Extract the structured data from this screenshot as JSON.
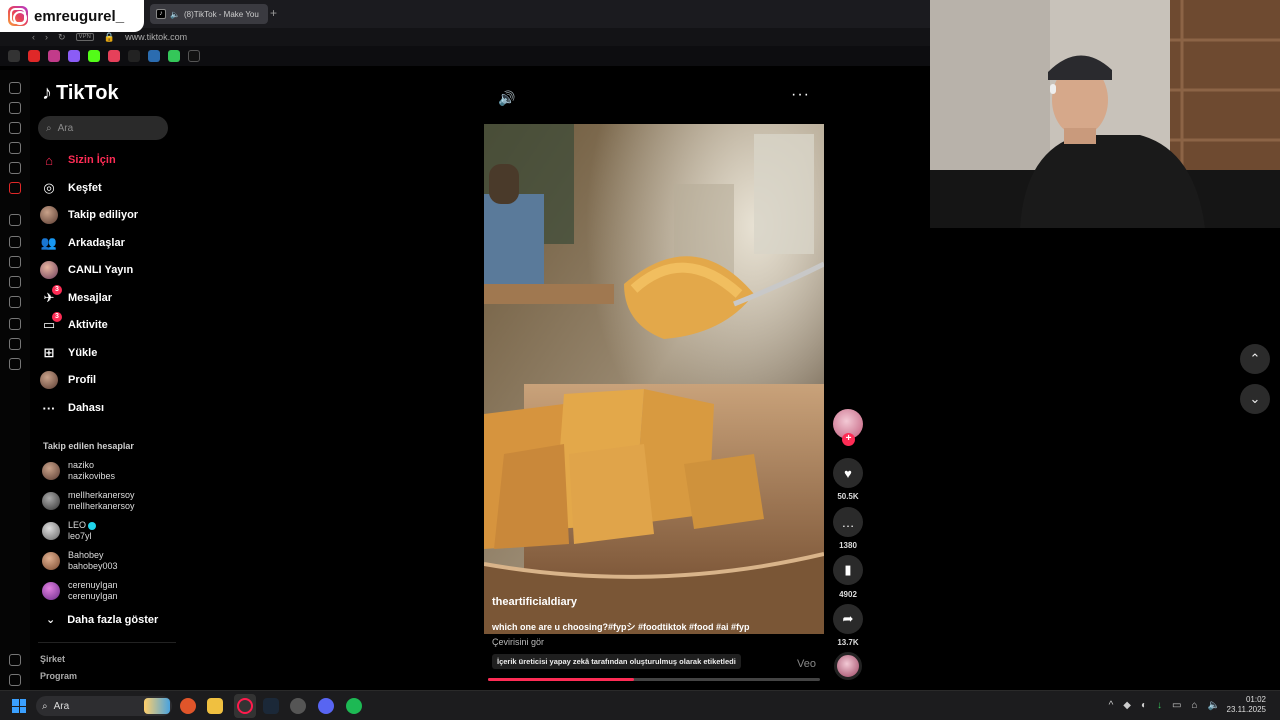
{
  "overlay": {
    "instagram_handle": "emreugurel_"
  },
  "browser": {
    "tab_title": "(8)TikTok - Make You",
    "url": "www.tiktok.com",
    "vpn_label": "VPN",
    "new_tab": "+"
  },
  "tiktok": {
    "logo_text": "TikTok",
    "search_placeholder": "Ara",
    "nav": [
      {
        "label": "Sizin İçin",
        "icon": "home-icon"
      },
      {
        "label": "Keşfet",
        "icon": "compass-icon"
      },
      {
        "label": "Takip ediliyor",
        "icon": "following-avatar"
      },
      {
        "label": "Arkadaşlar",
        "icon": "friends-icon"
      },
      {
        "label": "CANLI Yayın",
        "icon": "live-avatar"
      },
      {
        "label": "Mesajlar",
        "icon": "messages-icon",
        "badge": "3"
      },
      {
        "label": "Aktivite",
        "icon": "activity-icon",
        "badge": "3"
      },
      {
        "label": "Yükle",
        "icon": "upload-icon"
      },
      {
        "label": "Profil",
        "icon": "profile-avatar"
      },
      {
        "label": "Dahası",
        "icon": "more-icon"
      }
    ],
    "following_title": "Takip edilen hesaplar",
    "following": [
      {
        "name": "naziko",
        "handle": "nazikovibes"
      },
      {
        "name": "melIherkanersoy",
        "handle": "melIherkanersoy"
      },
      {
        "name": "LEO",
        "handle": "leo7yl",
        "verified": true
      },
      {
        "name": "Bahobey",
        "handle": "bahobey003"
      },
      {
        "name": "cerenuyIgan",
        "handle": "cerenuyIgan"
      }
    ],
    "show_more": "Daha fazla göster",
    "footer": [
      "Şirket",
      "Program"
    ]
  },
  "video": {
    "username": "theartificialdiary",
    "description": "which one are u choosing?#fypシ #foodtiktok #food #ai #fyp",
    "translate": "Çevirisini gör",
    "ai_label": "İçerik üreticisi yapay zekâ tarafından oluşturulmuş olarak etiketledi",
    "watermark": "Veo",
    "progress": 0.44,
    "likes": "50.5K",
    "comments": "1380",
    "saves": "4902",
    "shares": "13.7K"
  },
  "taskbar": {
    "search_placeholder": "Ara",
    "time": "01:02",
    "date": "23.11.2025"
  },
  "colors": {
    "accent": "#fe2c55",
    "bg": "#000000"
  }
}
